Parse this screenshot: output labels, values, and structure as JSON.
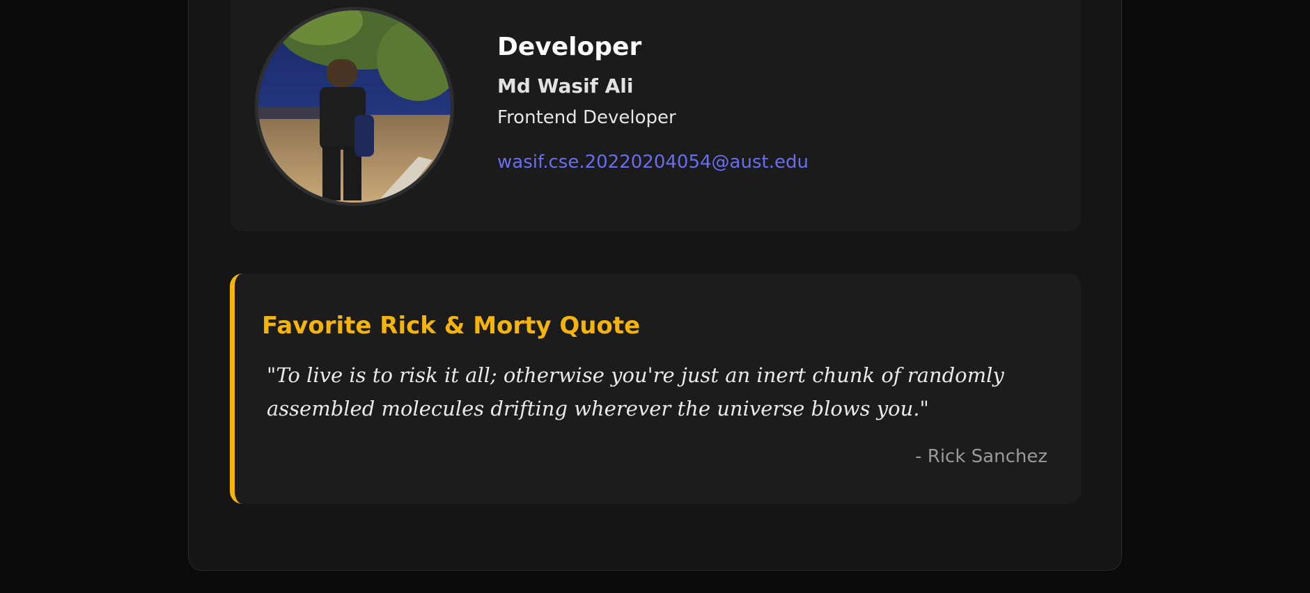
{
  "profile": {
    "heading": "Developer",
    "name": "Md Wasif Ali",
    "role": "Frontend Developer",
    "email": "wasif.cse.20220204054@aust.edu",
    "avatar_icon": "profile-photo"
  },
  "quote": {
    "heading": "Favorite Rick & Morty Quote",
    "text": "\"To live is to risk it all; otherwise you're just an inert chunk of randomly assembled molecules drifting wherever the universe blows you.\"",
    "author": "- Rick Sanchez"
  },
  "colors": {
    "background": "#0b0b0b",
    "card": "#1b1b1b",
    "accent": "#f5b40a",
    "link": "#6b6df0"
  }
}
